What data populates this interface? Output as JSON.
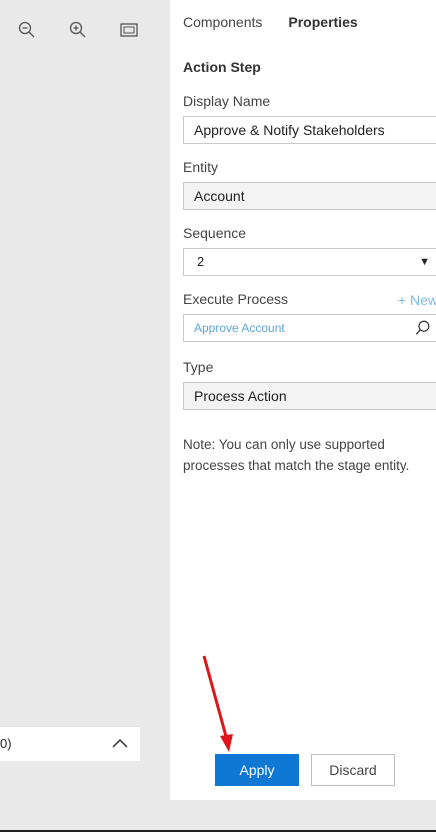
{
  "toolbar": {
    "zoom_out_icon": "zoom-out-icon",
    "zoom_in_icon": "zoom-in-icon",
    "fit_icon": "fit-to-screen-icon"
  },
  "panel": {
    "tabs": [
      {
        "label": "Components",
        "active": false
      },
      {
        "label": "Properties",
        "active": true
      }
    ],
    "section_title": "Action Step",
    "display_name": {
      "label": "Display Name",
      "value": "Approve & Notify Stakeholders"
    },
    "entity": {
      "label": "Entity",
      "value": "Account"
    },
    "sequence": {
      "label": "Sequence",
      "value": "2"
    },
    "execute_process": {
      "label": "Execute Process",
      "new_link": "+ New",
      "placeholder": "Approve Account"
    },
    "type": {
      "label": "Type",
      "value": "Process Action"
    },
    "note": "Note: You can only use supported processes that match the stage entity.",
    "apply_label": "Apply",
    "discard_label": "Discard"
  },
  "mini_panel": {
    "text": "0)"
  },
  "colors": {
    "accent": "#0f78d4",
    "link": "#7fb8e4",
    "annotation_arrow": "#e0151b"
  }
}
